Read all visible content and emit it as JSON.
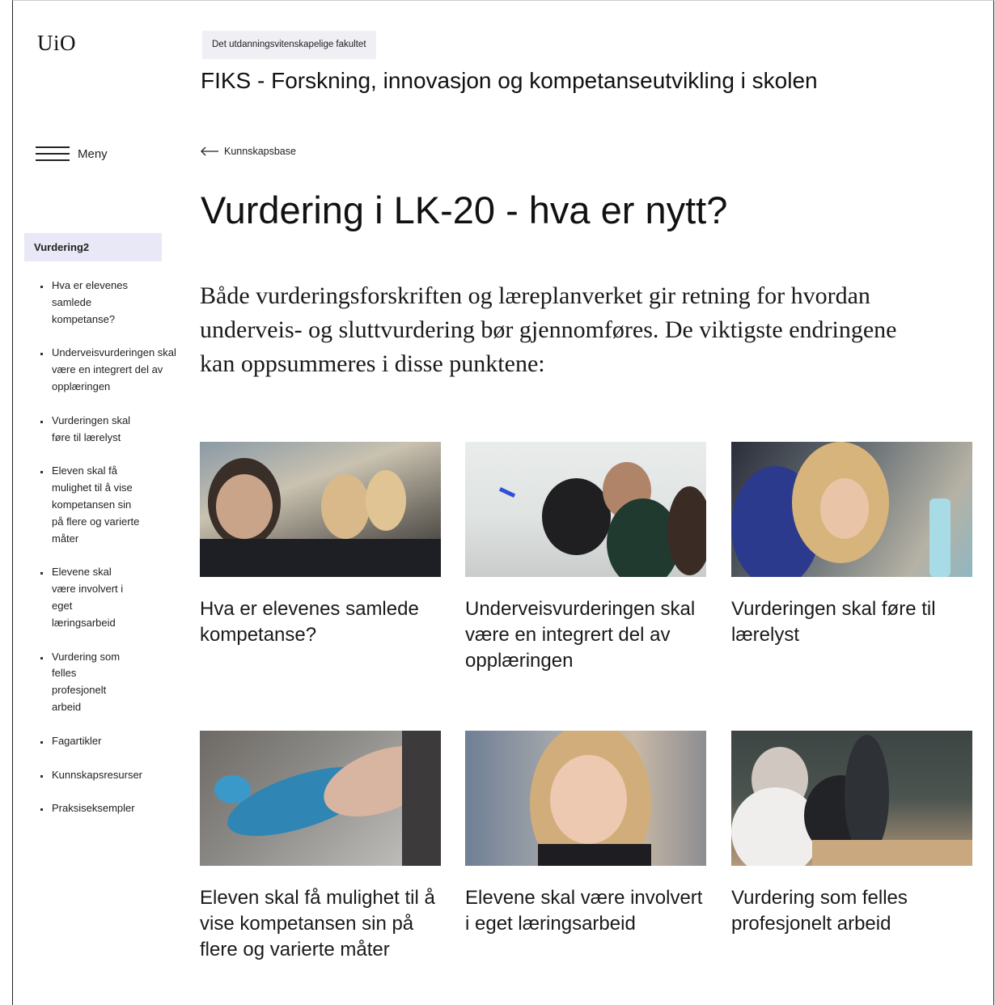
{
  "header": {
    "logo": "UiO",
    "faculty": "Det utdanningsvitenskapelige fakultet",
    "site_title": "FIKS - Forskning, innovasjon og kompetanseutvikling i skolen"
  },
  "menu": {
    "label": "Meny",
    "icon": "hamburger-icon"
  },
  "breadcrumb": {
    "label": "Kunnskapsbase",
    "icon": "arrow-left-icon"
  },
  "page": {
    "title": "Vurdering i LK-20 - hva er nytt?",
    "lead": "Både vurderingsforskriften og læreplanverket gir retning for hvordan underveis- og sluttvurdering bør gjennomføres. De viktigste endringene kan oppsummeres i disse punktene:"
  },
  "sidebar": {
    "heading": "Vurdering2",
    "items": [
      {
        "label": "Hva er elevenes samlede kompetanse?"
      },
      {
        "label": "Underveisvurderingen skal være en integrert del av opplæringen"
      },
      {
        "label": "Vurderingen skal føre til lærelyst"
      },
      {
        "label": "Eleven skal få mulighet til å vise kompetansen sin på flere og varierte måter"
      },
      {
        "label": "Elevene skal være involvert i eget læringsarbeid"
      },
      {
        "label": "Vurdering som felles profesjonelt arbeid"
      },
      {
        "label": "Fagartikler"
      },
      {
        "label": "Kunnskapsresurser"
      },
      {
        "label": "Praksiseksempler"
      }
    ]
  },
  "cards": [
    {
      "title": "Hva er elevenes samlede kompetanse?",
      "image": "students-at-laptops-photo"
    },
    {
      "title": "Underveisvurderingen skal være en integrert del av opplæringen",
      "image": "teacher-at-whiteboard-photo"
    },
    {
      "title": "Vurderingen skal føre til lærelyst",
      "image": "girl-with-glasses-photo"
    },
    {
      "title": "Eleven skal få mulighet til å vise kompetansen sin på flere og varierte måter",
      "image": "toy-dinosaur-photo"
    },
    {
      "title": "Elevene skal være involvert i eget læringsarbeid",
      "image": "girl-reading-photo"
    },
    {
      "title": "Vurdering som felles profesjonelt arbeid",
      "image": "teachers-meeting-photo"
    }
  ]
}
